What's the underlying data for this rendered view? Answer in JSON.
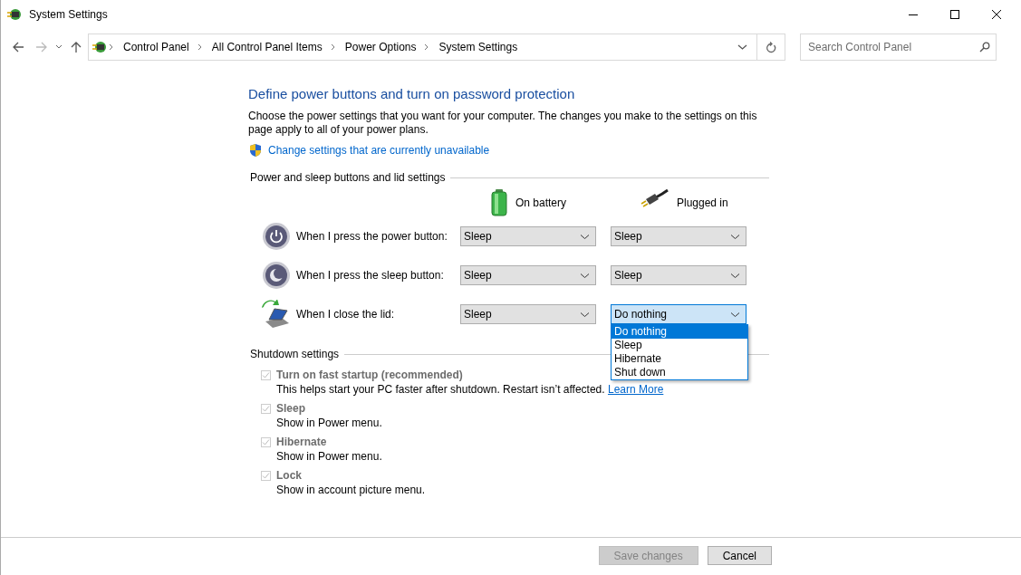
{
  "window": {
    "title": "System Settings"
  },
  "breadcrumb": [
    "Control Panel",
    "All Control Panel Items",
    "Power Options",
    "System Settings"
  ],
  "search": {
    "placeholder": "Search Control Panel"
  },
  "heading": "Define power buttons and turn on password protection",
  "intro": "Choose the power settings that you want for your computer. The changes you make to the settings on this page apply to all of your power plans.",
  "admin_link": "Change settings that are currently unavailable",
  "button_section": {
    "title": "Power and sleep buttons and lid settings",
    "columns": [
      {
        "kind": "battery",
        "label": "On battery"
      },
      {
        "kind": "plug",
        "label": "Plugged in"
      }
    ],
    "rows": [
      {
        "kind": "power",
        "label": "When I press the power button:",
        "settings": [
          {
            "value": "Sleep",
            "expanded": false
          },
          {
            "value": "Sleep",
            "expanded": false
          }
        ]
      },
      {
        "kind": "sleep",
        "label": "When I press the sleep button:",
        "settings": [
          {
            "value": "Sleep",
            "expanded": false
          },
          {
            "value": "Sleep",
            "expanded": false
          }
        ]
      },
      {
        "kind": "lid",
        "label": "When I close the lid:",
        "settings": [
          {
            "value": "Sleep",
            "expanded": false
          },
          {
            "value": "Do nothing",
            "expanded": true,
            "options": [
              {
                "label": "Do nothing",
                "selected": true
              },
              {
                "label": "Sleep",
                "selected": false
              },
              {
                "label": "Hibernate",
                "selected": false
              },
              {
                "label": "Shut down",
                "selected": false
              }
            ]
          }
        ]
      }
    ]
  },
  "shutdown": {
    "title": "Shutdown settings",
    "items": [
      {
        "label": "Turn on fast startup (recommended)",
        "checked": true,
        "disabled": true,
        "description": "This helps start your PC faster after shutdown. Restart isn’t affected.",
        "link": "Learn More"
      },
      {
        "label": "Sleep",
        "checked": true,
        "disabled": true,
        "description": "Show in Power menu."
      },
      {
        "label": "Hibernate",
        "checked": true,
        "disabled": true,
        "description": "Show in Power menu."
      },
      {
        "label": "Lock",
        "checked": true,
        "disabled": true,
        "description": "Show in account picture menu."
      }
    ]
  },
  "footer": {
    "buttons": [
      {
        "label": "Save changes",
        "disabled": true
      },
      {
        "label": "Cancel",
        "disabled": false
      }
    ]
  }
}
